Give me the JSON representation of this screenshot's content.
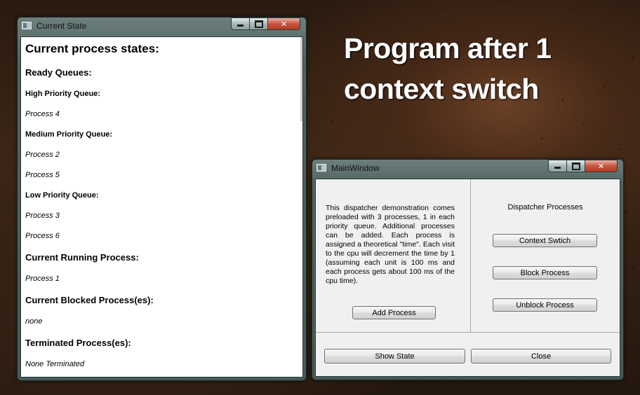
{
  "overlay": {
    "line1": "Program after 1",
    "line2": "context switch"
  },
  "state_window": {
    "title": "Current State",
    "heading": "Current process states:",
    "ready_heading": "Ready Queues:",
    "high_label": "High Priority Queue:",
    "high_items": [
      "Process 4"
    ],
    "medium_label": "Medium Priority Queue:",
    "medium_items": [
      "Process 2",
      "Process 5"
    ],
    "low_label": "Low Priority Queue:",
    "low_items": [
      "Process 3",
      "Process 6"
    ],
    "running_heading": "Current Running Process:",
    "running_value": "Process 1",
    "blocked_heading": "Current Blocked Process(es):",
    "blocked_value": "none",
    "terminated_heading": "Terminated Process(es):",
    "terminated_value": "None Terminated"
  },
  "main_window": {
    "title": "MainWindow",
    "description": "This dispatcher demonstration comes preloaded with 3 processes, 1 in each priority queue. Additional processes can be added. Each process is assigned a theoretical \"time\". Each visit to the cpu will decrement the time by 1 (assuming each unit is 100 ms and each process gets about 100 ms of the cpu time).",
    "add_process": "Add Process",
    "dispatcher_label": "Dispatcher Processes",
    "context_switch": "Context Swtich",
    "block_process": "Block Process",
    "unblock_process": "Unblock Process",
    "show_state": "Show State",
    "close": "Close"
  },
  "window_controls": {
    "close_glyph": "✕"
  },
  "icons": [
    "window-icon",
    "minimize-icon",
    "maximize-icon",
    "close-icon"
  ]
}
